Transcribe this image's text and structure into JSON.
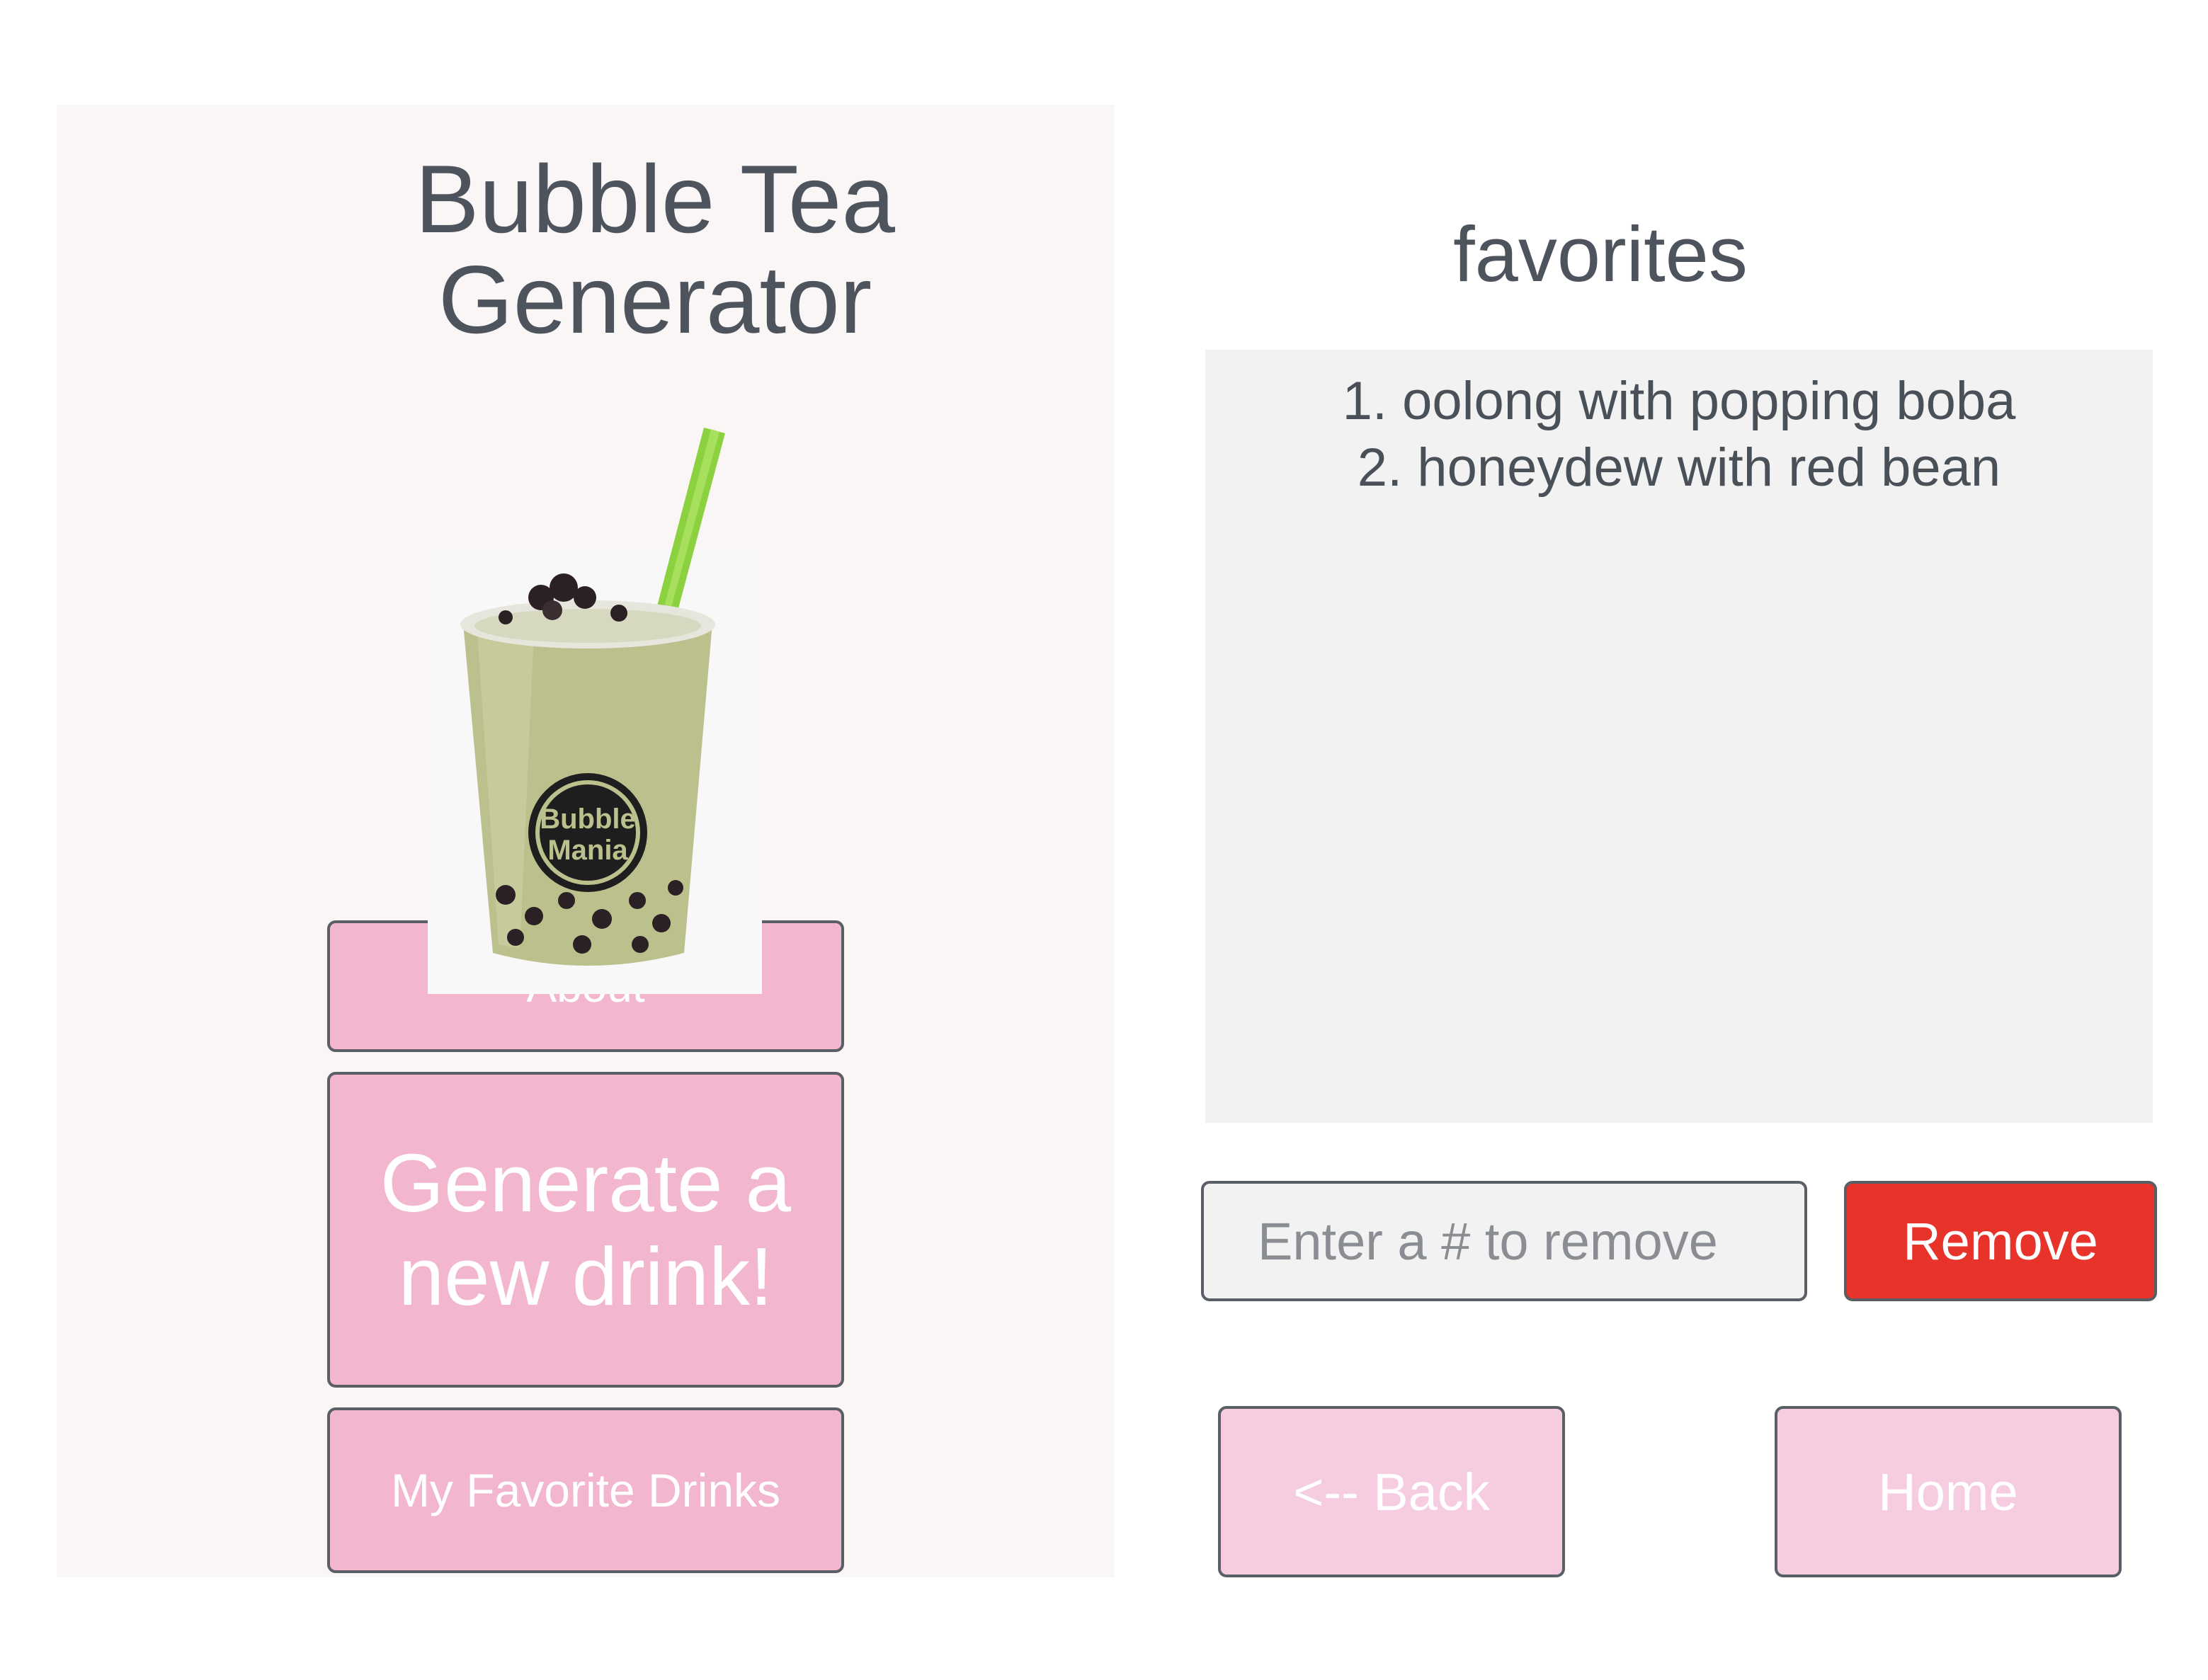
{
  "home": {
    "title_line1": "Bubble Tea",
    "title_line2": "Generator",
    "image": {
      "cup_logo_line1": "Bubble",
      "cup_logo_line2": "Mania",
      "cup_color": "#b9bf86",
      "straw_color": "#8cd13f",
      "pearl_color": "#2b2124"
    },
    "buttons": {
      "about": "About",
      "generate_line1": "Generate a",
      "generate_line2": "new drink!",
      "favorites": "My Favorite Drinks"
    }
  },
  "favorites": {
    "title": "favorites",
    "items": [
      "1. oolong with popping boba",
      "2. honeydew with red bean"
    ],
    "remove_input": {
      "placeholder": "Enter a # to remove",
      "value": ""
    },
    "remove_label": "Remove",
    "back_label": "<-- Back",
    "home_label": "Home"
  },
  "colors": {
    "pink_button": "#f2b6cf",
    "light_pink_button": "#f6cde0",
    "remove_red": "#e8332a",
    "panel_bg": "#fbf6f6",
    "list_bg": "#f2f2f2",
    "text": "#4a5058"
  }
}
